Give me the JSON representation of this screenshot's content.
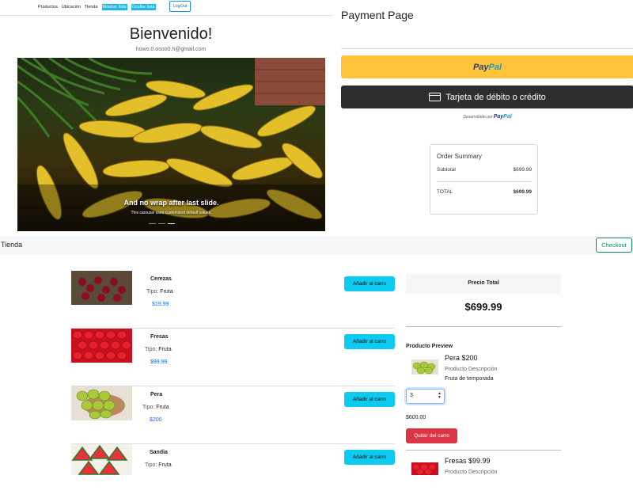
{
  "nav": {
    "links": [
      "Productos",
      "Ubicación",
      "Tienda"
    ],
    "highlighted": [
      "Mostrar lista",
      "Ocultar lista"
    ],
    "logout_label": "LogOut"
  },
  "home": {
    "title": "Bienvenido!",
    "email": "howo.0.osoo0.h@gmail.com",
    "carousel": {
      "caption_title": "And no wrap after last slide.",
      "caption_text": "This carousel uses customized default values.",
      "slide_count": 3,
      "active_slide": 3
    }
  },
  "payment": {
    "title": "Payment Page",
    "paypal_label_1": "Pay",
    "paypal_label_2": "Pal",
    "card_label": "Tarjeta de débito o crédito",
    "powered_label": "Desarrollado por",
    "powered_brand_1": "Pay",
    "powered_brand_2": "Pal",
    "summary": {
      "title": "Order Summary",
      "subtotal_label": "Subtotal",
      "subtotal_value": "$699.99",
      "total_label": "TOTAL",
      "total_value": "$699.99"
    }
  },
  "store": {
    "title": "Tienda",
    "checkout_label": "Checkout",
    "type_prefix": "Tipo:",
    "add_label": "Añadir al carro",
    "products": [
      {
        "name": "Cerezas",
        "type": "Fruta",
        "price": "$19.99"
      },
      {
        "name": "Fresas",
        "type": "Fruta",
        "price": "$99.99"
      },
      {
        "name": "Pera",
        "type": "Fruta",
        "price": "$200"
      },
      {
        "name": "Sandia",
        "type": "Fruta",
        "price": ""
      }
    ],
    "total_label": "Precio Total",
    "total_value": "$699.99",
    "preview": {
      "title": "Producto Preview",
      "name": "Pera $200",
      "desc": "Producto Descripción",
      "desc2": "Fruta de temporada",
      "quantity": "3",
      "subtotal": "$600.00",
      "remove_label": "Quitar del carro"
    },
    "cart_next": {
      "name": "Fresas $99.99",
      "desc": "Producto Descripción"
    }
  },
  "colors": {
    "paypal_yellow": "#ffc439",
    "card_dark": "#2c2e2f",
    "info_cyan": "#0dcaf0",
    "danger_red": "#dc3545",
    "success_green": "#198754",
    "link_blue": "#0d6efd"
  }
}
